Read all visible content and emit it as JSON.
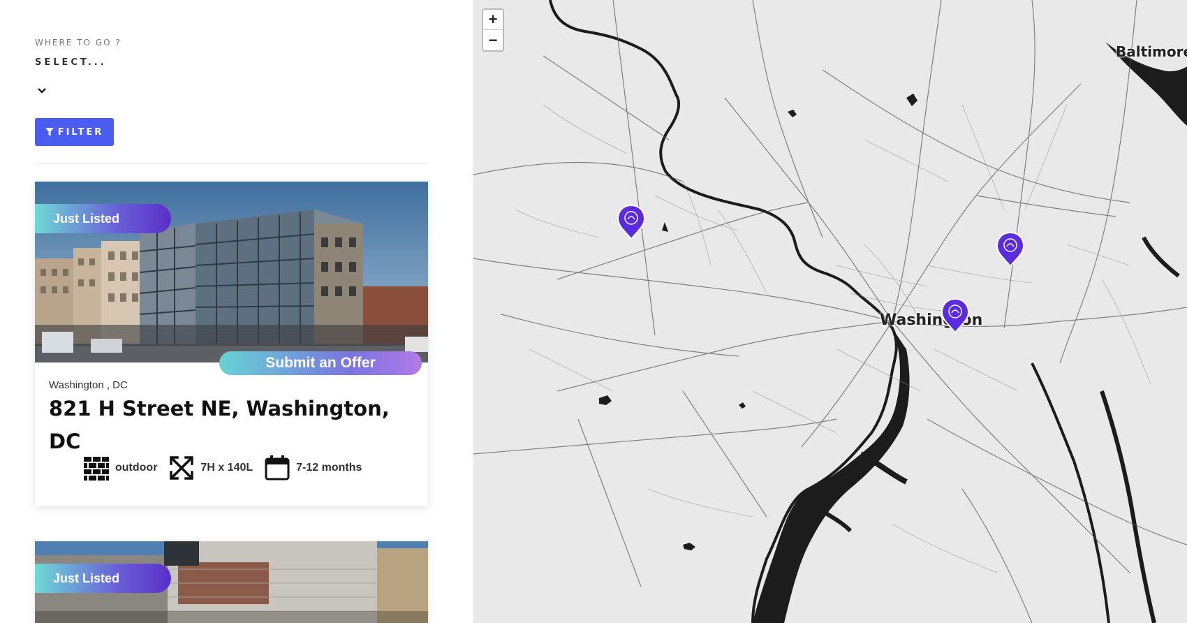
{
  "filter": {
    "where_label": "WHERE TO GO ?",
    "select_value": "SELECT...",
    "filter_button": "FILTER"
  },
  "listings": [
    {
      "badge": "Just Listed",
      "offer_button": "Submit an Offer",
      "location": "Washington , DC",
      "title": "821 H Street NE, Washington, DC",
      "specs": [
        {
          "icon": "brick-wall-icon",
          "label": "outdoor"
        },
        {
          "icon": "expand-arrows-icon",
          "label": "7H x 140L"
        },
        {
          "icon": "calendar-icon",
          "label": "7-12 months"
        }
      ]
    },
    {
      "badge": "Just Listed"
    }
  ],
  "map": {
    "zoom_in": "+",
    "zoom_out": "−",
    "cities": [
      "Washington",
      "Baltimore"
    ],
    "pin_color": "#5b2be0",
    "pins": 3
  },
  "colors": {
    "accent": "#4b5cf0",
    "badge_start": "#6ed9d5",
    "badge_end": "#5a2fc9",
    "water": "#1c1c1c",
    "land": "#e9e9e9"
  }
}
